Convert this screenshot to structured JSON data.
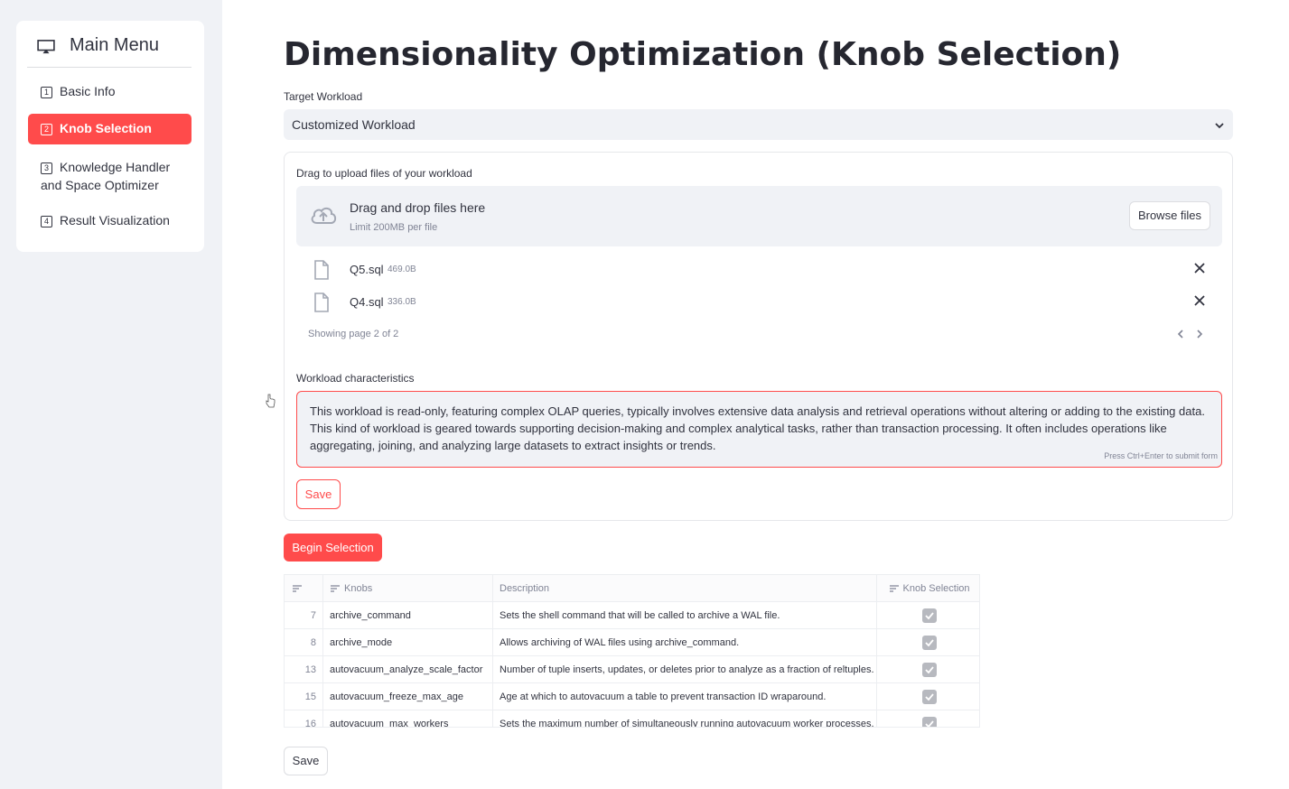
{
  "sidebar": {
    "title": "Main Menu",
    "items": [
      {
        "num": "1",
        "label": "Basic Info",
        "active": false
      },
      {
        "num": "2",
        "label": "Knob Selection",
        "active": true
      },
      {
        "num": "3",
        "label": "Knowledge Handler and Space Optimizer",
        "active": false
      },
      {
        "num": "4",
        "label": "Result Visualization",
        "active": false
      }
    ]
  },
  "main": {
    "title": "Dimensionality Optimization (Knob Selection)",
    "workload_label": "Target Workload",
    "workload_value": "Customized Workload",
    "upload_label": "Drag to upload files of your workload",
    "drop_text": "Drag and drop files here",
    "drop_limit": "Limit 200MB per file",
    "browse_label": "Browse files",
    "files": [
      {
        "name": "Q5.sql",
        "size": "469.0B"
      },
      {
        "name": "Q4.sql",
        "size": "336.0B"
      }
    ],
    "page_text": "Showing page 2 of 2",
    "characteristics_label": "Workload characteristics",
    "characteristics_text": "This workload is read-only, featuring complex OLAP queries, typically involves extensive data analysis and retrieval operations without altering or adding to the existing data. This kind of workload is geared towards supporting decision-making and complex analytical tasks, rather than transaction processing. It often includes operations like aggregating, joining, and analyzing large datasets to extract insights or trends.",
    "submit_hint": "Press Ctrl+Enter to submit form",
    "save_label": "Save",
    "begin_label": "Begin Selection",
    "table": {
      "headers": [
        "Knobs",
        "Description",
        "Knob Selection"
      ],
      "rows": [
        {
          "idx": "7",
          "knob": "archive_command",
          "desc": "Sets the shell command that will be called to archive a WAL file.",
          "selected": true
        },
        {
          "idx": "8",
          "knob": "archive_mode",
          "desc": "Allows archiving of WAL files using archive_command.",
          "selected": true
        },
        {
          "idx": "13",
          "knob": "autovacuum_analyze_scale_factor",
          "desc": "Number of tuple inserts, updates, or deletes prior to analyze as a fraction of reltuples.",
          "selected": true
        },
        {
          "idx": "15",
          "knob": "autovacuum_freeze_max_age",
          "desc": "Age at which to autovacuum a table to prevent transaction ID wraparound.",
          "selected": true
        },
        {
          "idx": "16",
          "knob": "autovacuum_max_workers",
          "desc": "Sets the maximum number of simultaneously running autovacuum worker processes.",
          "selected": true
        }
      ]
    },
    "save_bottom_label": "Save"
  },
  "colors": {
    "accent": "#ff4b4b",
    "sidebar_bg": "#f0f2f6"
  }
}
